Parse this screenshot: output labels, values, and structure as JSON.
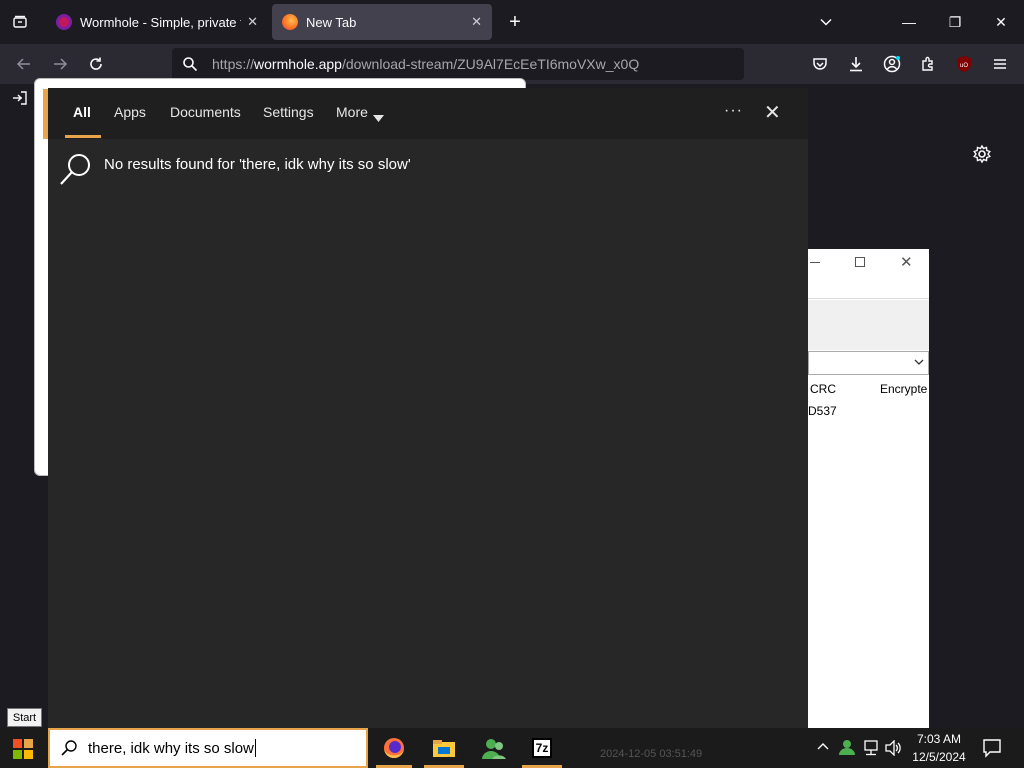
{
  "browser": {
    "tabs": [
      {
        "title": "Wormhole - Simple, private file",
        "close": "✕"
      },
      {
        "title": "New Tab",
        "close": "✕"
      }
    ],
    "new_tab": "+",
    "url_host": "wormhole.app",
    "url_prefix": "https://",
    "url_path": "/download-stream/ZU9Al7EcEeTI6moVXw_x0Q",
    "window_controls": {
      "minimize": "—",
      "restore": "❐",
      "close": "✕"
    }
  },
  "background_window": {
    "col_crc": "CRC",
    "col_encrypted": "Encrypte",
    "row_crc": "D537"
  },
  "search_flyout": {
    "tabs": [
      "All",
      "Apps",
      "Documents",
      "Settings",
      "More"
    ],
    "more_icon": "caret-down-icon",
    "ellipsis": "···",
    "close": "✕",
    "message": "No results found for 'there, idk why its so slow'"
  },
  "taskbar": {
    "start_tooltip": "Start",
    "search_text": "there, idk why its so slow",
    "faint_file": "2024-12-05 03:51:49",
    "app_7z": "7z",
    "time": "7:03 AM",
    "date": "12/5/2024"
  },
  "colors": {
    "accent": "#e8a44a",
    "flyout_bg": "#272727",
    "taskbar_bg": "#1b1b1b"
  }
}
